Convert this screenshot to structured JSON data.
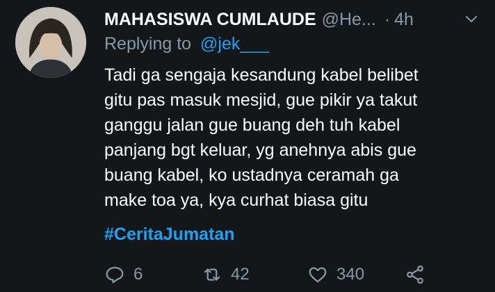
{
  "tweet": {
    "author": {
      "display_name": "MAHASISWA CUMLAUDE",
      "handle": "@He...",
      "time_sep": "·",
      "time": "4h"
    },
    "replying": {
      "label": "Replying to",
      "mention": "@jek___"
    },
    "body_lines": [
      "Tadi ga sengaja kesandung kabel belibet",
      "gitu pas masuk mesjid, gue pikir ya takut",
      "ganggu jalan gue buang deh tuh kabel",
      "panjang bgt keluar, yg anehnya abis gue",
      "buang kabel, ko ustadnya ceramah ga",
      "make toa ya, kya curhat biasa gitu"
    ],
    "hashtag": "#CeritaJumatan",
    "actions": {
      "reply_count": "6",
      "retweet_count": "42",
      "like_count": "340"
    }
  },
  "colors": {
    "background": "#14171a",
    "text_primary": "#ffffff",
    "text_secondary": "#8899a6",
    "accent": "#1da1f2"
  },
  "icons": {
    "caret": "chevron-down-icon",
    "reply": "reply-icon",
    "retweet": "retweet-icon",
    "like": "heart-icon",
    "share": "share-icon"
  }
}
